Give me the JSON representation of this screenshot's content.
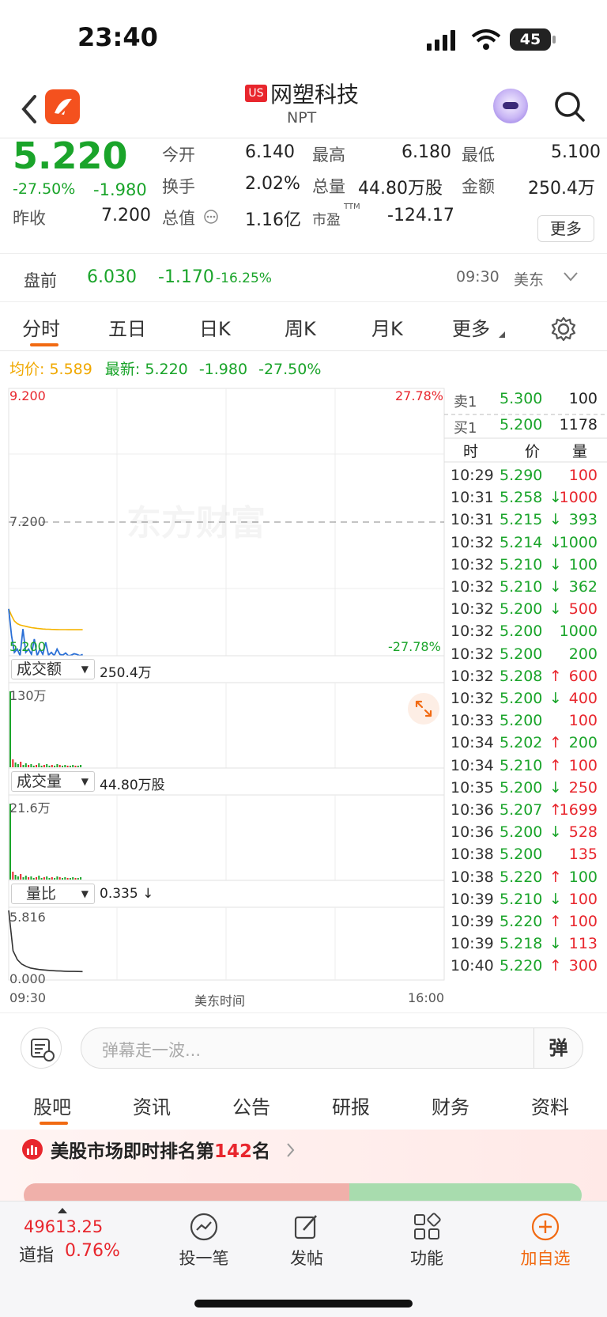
{
  "status": {
    "time": "23:40",
    "battery": "45"
  },
  "header": {
    "market_badge": "US",
    "name": "网塑科技",
    "ticker": "NPT"
  },
  "quote": {
    "price": "5.220",
    "change_pct": "-27.50%",
    "change": "-1.980",
    "open_label": "今开",
    "open": "6.140",
    "high_label": "最高",
    "high": "6.180",
    "low_label": "最低",
    "low": "5.100",
    "turnover_label": "换手",
    "turnover": "2.02%",
    "volume_label": "总量",
    "volume": "44.80万股",
    "amount_label": "金额",
    "amount": "250.4万",
    "prev_label": "昨收",
    "prev": "7.200",
    "mktcap_label": "总值",
    "mktcap": "1.16亿",
    "pe_label": "市盈",
    "pe_sup": "TTM",
    "pe": "-124.17",
    "more": "更多"
  },
  "premarket": {
    "label": "盘前",
    "price": "6.030",
    "change": "-1.170",
    "pct": "-16.25%",
    "time": "09:30",
    "zone": "美东"
  },
  "tabs": [
    "分时",
    "五日",
    "日K",
    "周K",
    "月K",
    "更多"
  ],
  "avg": {
    "avg_label": "均价:",
    "avg": "5.589",
    "last_label": "最新:",
    "last": "5.220",
    "chg": "-1.980",
    "pct": "-27.50%"
  },
  "chart": {
    "y_top": "9.200",
    "y_mid": "7.200",
    "y_bottom": "5.200",
    "pct_top": "27.78%",
    "pct_bottom": "-27.78%",
    "watermark": "东方财富",
    "amount_label": "成交额",
    "amount_value": "250.4万",
    "amount_max": "130万",
    "volume_label": "成交量",
    "volume_value": "44.80万股",
    "volume_max": "21.6万",
    "ratio_label": "量比",
    "ratio_value": "0.335 ↓",
    "ratio_max": "5.816",
    "ratio_min": "0.000",
    "x_start": "09:30",
    "x_mid": "美东时间",
    "x_end": "16:00",
    "price_values": [
      5.9,
      5.5,
      5.25,
      5.3,
      5.2,
      5.6,
      5.25,
      5.3,
      5.22,
      5.45,
      5.2,
      5.3,
      5.22,
      5.4,
      5.21,
      5.25,
      5.2,
      5.3,
      5.22,
      5.21,
      5.24,
      5.2,
      5.21,
      5.23,
      5.22,
      5.2,
      5.22
    ],
    "avg_values": [
      5.9,
      5.8,
      5.72,
      5.68,
      5.66,
      5.65,
      5.64,
      5.63,
      5.62,
      5.615,
      5.61,
      5.605,
      5.6,
      5.598,
      5.596,
      5.594,
      5.593,
      5.592,
      5.591,
      5.59,
      5.59,
      5.589,
      5.589,
      5.589,
      5.589,
      5.589,
      5.589
    ],
    "ratio_values": [
      5.816,
      2.2,
      1.4,
      1.0,
      0.8,
      0.65,
      0.58,
      0.52,
      0.48,
      0.45,
      0.42,
      0.4,
      0.38,
      0.36,
      0.35,
      0.345,
      0.34,
      0.335
    ]
  },
  "orderbook": {
    "ask_label": "卖1",
    "ask_price": "5.300",
    "ask_vol": "100",
    "bid_label": "买1",
    "bid_price": "5.200",
    "bid_vol": "1178",
    "headers": [
      "时",
      "价",
      "量"
    ],
    "trades": [
      {
        "t": "10:29",
        "p": "5.290",
        "d": "",
        "v": "100",
        "c": "r"
      },
      {
        "t": "10:31",
        "p": "5.258",
        "d": "↓",
        "v": "1000",
        "c": "r"
      },
      {
        "t": "10:31",
        "p": "5.215",
        "d": "↓",
        "v": "393",
        "c": "g"
      },
      {
        "t": "10:32",
        "p": "5.214",
        "d": "↓",
        "v": "1000",
        "c": "g"
      },
      {
        "t": "10:32",
        "p": "5.210",
        "d": "↓",
        "v": "100",
        "c": "g"
      },
      {
        "t": "10:32",
        "p": "5.210",
        "d": "↓",
        "v": "362",
        "c": "g"
      },
      {
        "t": "10:32",
        "p": "5.200",
        "d": "↓",
        "v": "500",
        "c": "r"
      },
      {
        "t": "10:32",
        "p": "5.200",
        "d": "",
        "v": "1000",
        "c": "g"
      },
      {
        "t": "10:32",
        "p": "5.200",
        "d": "",
        "v": "200",
        "c": "g"
      },
      {
        "t": "10:32",
        "p": "5.208",
        "d": "↑",
        "v": "600",
        "c": "r"
      },
      {
        "t": "10:32",
        "p": "5.200",
        "d": "↓",
        "v": "400",
        "c": "r"
      },
      {
        "t": "10:33",
        "p": "5.200",
        "d": "",
        "v": "100",
        "c": "r"
      },
      {
        "t": "10:34",
        "p": "5.202",
        "d": "↑",
        "v": "200",
        "c": "g"
      },
      {
        "t": "10:34",
        "p": "5.210",
        "d": "↑",
        "v": "100",
        "c": "r"
      },
      {
        "t": "10:35",
        "p": "5.200",
        "d": "↓",
        "v": "250",
        "c": "r"
      },
      {
        "t": "10:36",
        "p": "5.207",
        "d": "↑",
        "v": "1699",
        "c": "r"
      },
      {
        "t": "10:36",
        "p": "5.200",
        "d": "↓",
        "v": "528",
        "c": "r"
      },
      {
        "t": "10:38",
        "p": "5.200",
        "d": "",
        "v": "135",
        "c": "r"
      },
      {
        "t": "10:38",
        "p": "5.220",
        "d": "↑",
        "v": "100",
        "c": "g"
      },
      {
        "t": "10:39",
        "p": "5.210",
        "d": "↓",
        "v": "100",
        "c": "r"
      },
      {
        "t": "10:39",
        "p": "5.220",
        "d": "↑",
        "v": "100",
        "c": "r"
      },
      {
        "t": "10:39",
        "p": "5.218",
        "d": "↓",
        "v": "113",
        "c": "r"
      },
      {
        "t": "10:40",
        "p": "5.220",
        "d": "↑",
        "v": "300",
        "c": "r"
      }
    ]
  },
  "danmu": {
    "placeholder": "弹幕走一波...",
    "btn": "弹"
  },
  "subtabs": [
    "股吧",
    "资讯",
    "公告",
    "研报",
    "财务",
    "资料"
  ],
  "rank": {
    "prefix": "美股市场即时排名第",
    "num": "142",
    "suffix": "名"
  },
  "bottom": {
    "index_value": "49613.25",
    "index_name": "道指",
    "index_pct": "0.76%",
    "items": [
      "投一笔",
      "发帖",
      "功能",
      "加自选"
    ]
  },
  "colors": {
    "up": "#e8262d",
    "down": "#1aa42a",
    "accent": "#f16a12"
  }
}
